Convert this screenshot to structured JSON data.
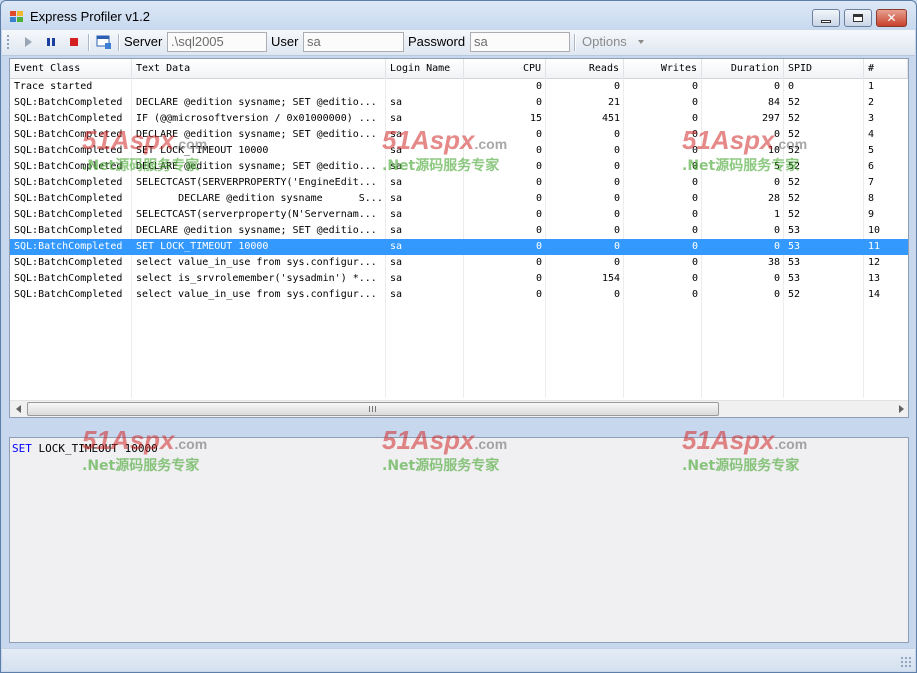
{
  "window": {
    "title": "Express Profiler v1.2"
  },
  "toolbar": {
    "server_label": "Server",
    "server_value": ".\\sql2005",
    "user_label": "User",
    "user_value": "sa",
    "password_label": "Password",
    "password_value": "sa",
    "options_label": "Options"
  },
  "columns": [
    "Event Class",
    "Text Data",
    "Login Name",
    "CPU",
    "Reads",
    "Writes",
    "Duration",
    "SPID",
    "#"
  ],
  "rows": [
    [
      "Trace started",
      "",
      "",
      "0",
      "0",
      "0",
      "0",
      "0",
      "1"
    ],
    [
      "SQL:BatchCompleted",
      "DECLARE @edition sysname; SET @editio...",
      "sa",
      "0",
      "21",
      "0",
      "84",
      "52",
      "2"
    ],
    [
      "SQL:BatchCompleted",
      "IF (@@microsoftversion / 0x01000000) ...",
      "sa",
      "15",
      "451",
      "0",
      "297",
      "52",
      "3"
    ],
    [
      "SQL:BatchCompleted",
      "DECLARE @edition sysname; SET @editio...",
      "sa",
      "0",
      "0",
      "0",
      "0",
      "52",
      "4"
    ],
    [
      "SQL:BatchCompleted",
      "SET LOCK_TIMEOUT 10000",
      "sa",
      "0",
      "0",
      "0",
      "10",
      "52",
      "5"
    ],
    [
      "SQL:BatchCompleted",
      "DECLARE @edition sysname; SET @editio...",
      "sa",
      "0",
      "0",
      "0",
      "5",
      "52",
      "6"
    ],
    [
      "SQL:BatchCompleted",
      "SELECTCAST(SERVERPROPERTY('EngineEdit...",
      "sa",
      "0",
      "0",
      "0",
      "0",
      "52",
      "7"
    ],
    [
      "SQL:BatchCompleted",
      "       DECLARE @edition sysname      S...",
      "sa",
      "0",
      "0",
      "0",
      "28",
      "52",
      "8"
    ],
    [
      "SQL:BatchCompleted",
      "SELECTCAST(serverproperty(N'Servernam...",
      "sa",
      "0",
      "0",
      "0",
      "1",
      "52",
      "9"
    ],
    [
      "SQL:BatchCompleted",
      "DECLARE @edition sysname; SET @editio...",
      "sa",
      "0",
      "0",
      "0",
      "0",
      "53",
      "10"
    ],
    [
      "SQL:BatchCompleted",
      "SET LOCK_TIMEOUT 10000",
      "sa",
      "0",
      "0",
      "0",
      "0",
      "53",
      "11"
    ],
    [
      "SQL:BatchCompleted",
      "select value_in_use from sys.configur...",
      "sa",
      "0",
      "0",
      "0",
      "38",
      "53",
      "12"
    ],
    [
      "SQL:BatchCompleted",
      "select is_srvrolemember('sysadmin') *...",
      "sa",
      "0",
      "154",
      "0",
      "0",
      "53",
      "13"
    ],
    [
      "SQL:BatchCompleted",
      "select value_in_use from sys.configur...",
      "sa",
      "0",
      "0",
      "0",
      "0",
      "52",
      "14"
    ]
  ],
  "selected_row": 10,
  "detail": {
    "keyword": "SET",
    "text": " LOCK_TIMEOUT 10000"
  },
  "watermark": {
    "logo": "51Aspx",
    "logo_suffix": ".com",
    "tagline": ".Net源码服务专家"
  },
  "colors": {
    "selection": "#3399ff",
    "keyword": "#0000ff",
    "stop_button": "#d42020",
    "pause_button": "#1a3f9e"
  },
  "icons": {
    "app": "profiler-app-icon",
    "start": "play-icon",
    "pause": "pause-icon",
    "stop": "stop-icon",
    "clear": "clear-trace-icon"
  }
}
